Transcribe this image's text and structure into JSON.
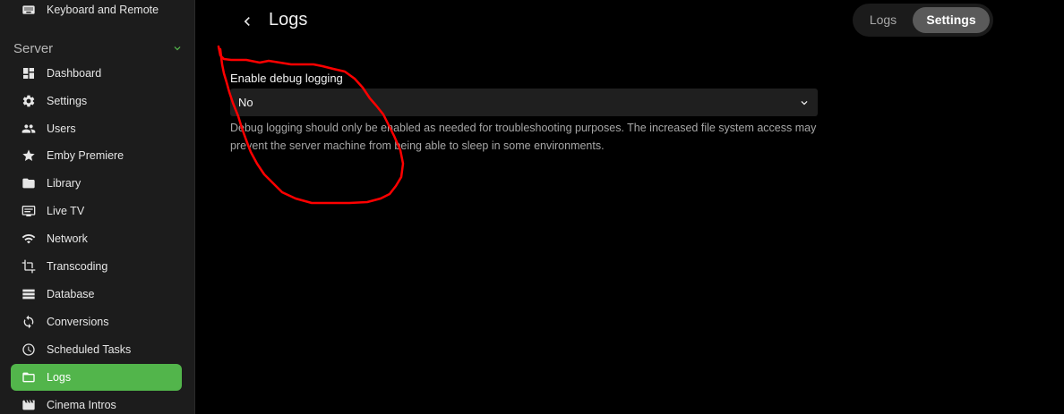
{
  "sidebar": {
    "top_item": {
      "label": "Keyboard and Remote",
      "icon": "keyboard-icon"
    },
    "section": {
      "label": "Server",
      "icon": "chevron-down-icon",
      "accent": "#52b54b"
    },
    "items": [
      {
        "label": "Dashboard",
        "icon": "dashboard-icon"
      },
      {
        "label": "Settings",
        "icon": "gear-icon"
      },
      {
        "label": "Users",
        "icon": "users-icon"
      },
      {
        "label": "Emby Premiere",
        "icon": "star-icon"
      },
      {
        "label": "Library",
        "icon": "folder-icon"
      },
      {
        "label": "Live TV",
        "icon": "live-tv-icon"
      },
      {
        "label": "Network",
        "icon": "wifi-icon"
      },
      {
        "label": "Transcoding",
        "icon": "crop-icon"
      },
      {
        "label": "Database",
        "icon": "database-icon"
      },
      {
        "label": "Conversions",
        "icon": "sync-icon"
      },
      {
        "label": "Scheduled Tasks",
        "icon": "clock-icon"
      },
      {
        "label": "Logs",
        "icon": "folder-outline-icon",
        "active": true
      },
      {
        "label": "Cinema Intros",
        "icon": "film-icon"
      }
    ]
  },
  "header": {
    "title": "Logs",
    "back_icon": "chevron-left-icon",
    "tabs": [
      {
        "label": "Logs",
        "selected": false
      },
      {
        "label": "Settings",
        "selected": true
      }
    ]
  },
  "form": {
    "debug_logging": {
      "label": "Enable debug logging",
      "value": "No",
      "icon": "chevron-down-icon",
      "description": "Debug logging should only be enabled as needed for troubleshooting purposes. The increased file system access may prevent the server machine from being able to sleep in some environments."
    }
  },
  "colors": {
    "background": "#000000",
    "sidebar": "#1c1c1c",
    "accent": "#52b54b",
    "annotation": "#ff0000"
  }
}
